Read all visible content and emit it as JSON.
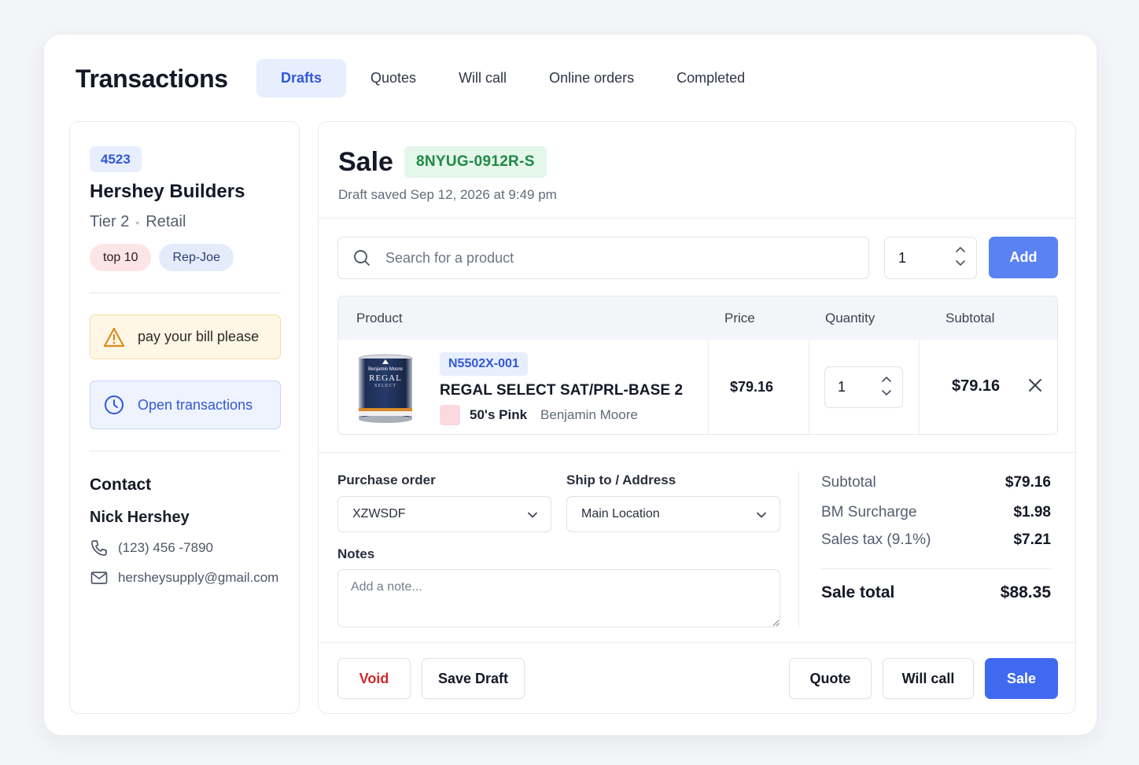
{
  "header": {
    "title": "Transactions",
    "tabs": [
      {
        "label": "Drafts",
        "active": true
      },
      {
        "label": "Quotes",
        "active": false
      },
      {
        "label": "Will call",
        "active": false
      },
      {
        "label": "Online orders",
        "active": false
      },
      {
        "label": "Completed",
        "active": false
      }
    ]
  },
  "customer": {
    "id": "4523",
    "name": "Hershey Builders",
    "tier": "Tier 2",
    "type": "Retail",
    "tags": [
      "top 10",
      "Rep-Joe"
    ],
    "alert": "pay your bill please",
    "open_transactions_label": "Open transactions",
    "contact_heading": "Contact",
    "contact_name": "Nick Hershey",
    "phone": "(123) 456 -7890",
    "email": "hersheysupply@gmail.com"
  },
  "sale": {
    "title": "Sale",
    "id": "8NYUG-0912R-S",
    "draft_saved": "Draft saved Sep 12, 2026 at 9:49 pm"
  },
  "search": {
    "placeholder": "Search for a product",
    "quantity": "1",
    "add_label": "Add"
  },
  "table": {
    "headers": [
      "Product",
      "Price",
      "Quantity",
      "Subtotal"
    ],
    "rows": [
      {
        "sku": "N5502X-001",
        "name": "REGAL SELECT SAT/PRL-BASE 2",
        "color_name": "50's Pink",
        "brand": "Benjamin Moore",
        "image_brand": "Benjamin Moore",
        "image_label": "REGAL",
        "image_sublabel": "SELECT",
        "price": "$79.16",
        "quantity": "1",
        "subtotal": "$79.16"
      }
    ]
  },
  "form": {
    "po_label": "Purchase order",
    "po_value": "XZWSDF",
    "ship_label": "Ship to / Address",
    "ship_value": "Main Location",
    "notes_label": "Notes",
    "notes_placeholder": "Add a note..."
  },
  "summary": {
    "subtotal_label": "Subtotal",
    "subtotal": "$79.16",
    "surcharge_label": "BM Surcharge",
    "surcharge": "$1.98",
    "tax_label": "Sales tax (9.1%)",
    "tax": "$7.21",
    "total_label": "Sale total",
    "total": "$88.35"
  },
  "actions": {
    "void": "Void",
    "save_draft": "Save Draft",
    "quote": "Quote",
    "will_call": "Will call",
    "sale": "Sale"
  },
  "colors": {
    "accent": "#3f6af0",
    "badge_green": "#1f8a45",
    "void_red": "#d12a2a",
    "swatch": "#fbd9de"
  }
}
